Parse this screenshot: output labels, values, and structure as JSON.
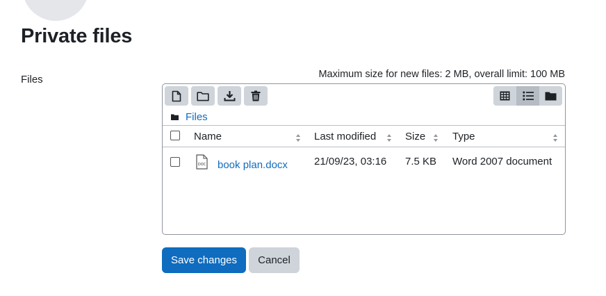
{
  "page": {
    "title": "Private files"
  },
  "form": {
    "files_label": "Files",
    "max_size_text": "Maximum size for new files: 2 MB, overall limit: 100 MB"
  },
  "filemanager": {
    "toolbar": [
      {
        "name": "add-file",
        "icon": "file-icon"
      },
      {
        "name": "create-folder",
        "icon": "folder-icon"
      },
      {
        "name": "download",
        "icon": "download-icon"
      },
      {
        "name": "delete",
        "icon": "trash-icon"
      }
    ],
    "views": [
      {
        "name": "view-icons",
        "icon": "grid-icon",
        "active": false
      },
      {
        "name": "view-details",
        "icon": "list-icon",
        "active": true
      },
      {
        "name": "view-tree",
        "icon": "folder-icon",
        "active": false
      }
    ],
    "path": {
      "label": "Files"
    },
    "columns": {
      "name": "Name",
      "modified": "Last modified",
      "size": "Size",
      "type": "Type"
    },
    "rows": [
      {
        "name": "book plan.docx",
        "modified": "21/09/23, 03:16",
        "size": "7.5 KB",
        "type": "Word 2007 document",
        "icon": "doc-file-icon",
        "icon_label": "DOC"
      }
    ]
  },
  "actions": {
    "save": "Save changes",
    "cancel": "Cancel"
  },
  "colors": {
    "primary": "#0f6cbf",
    "secondary_btn": "#ced4da",
    "border": "#8f959e"
  }
}
